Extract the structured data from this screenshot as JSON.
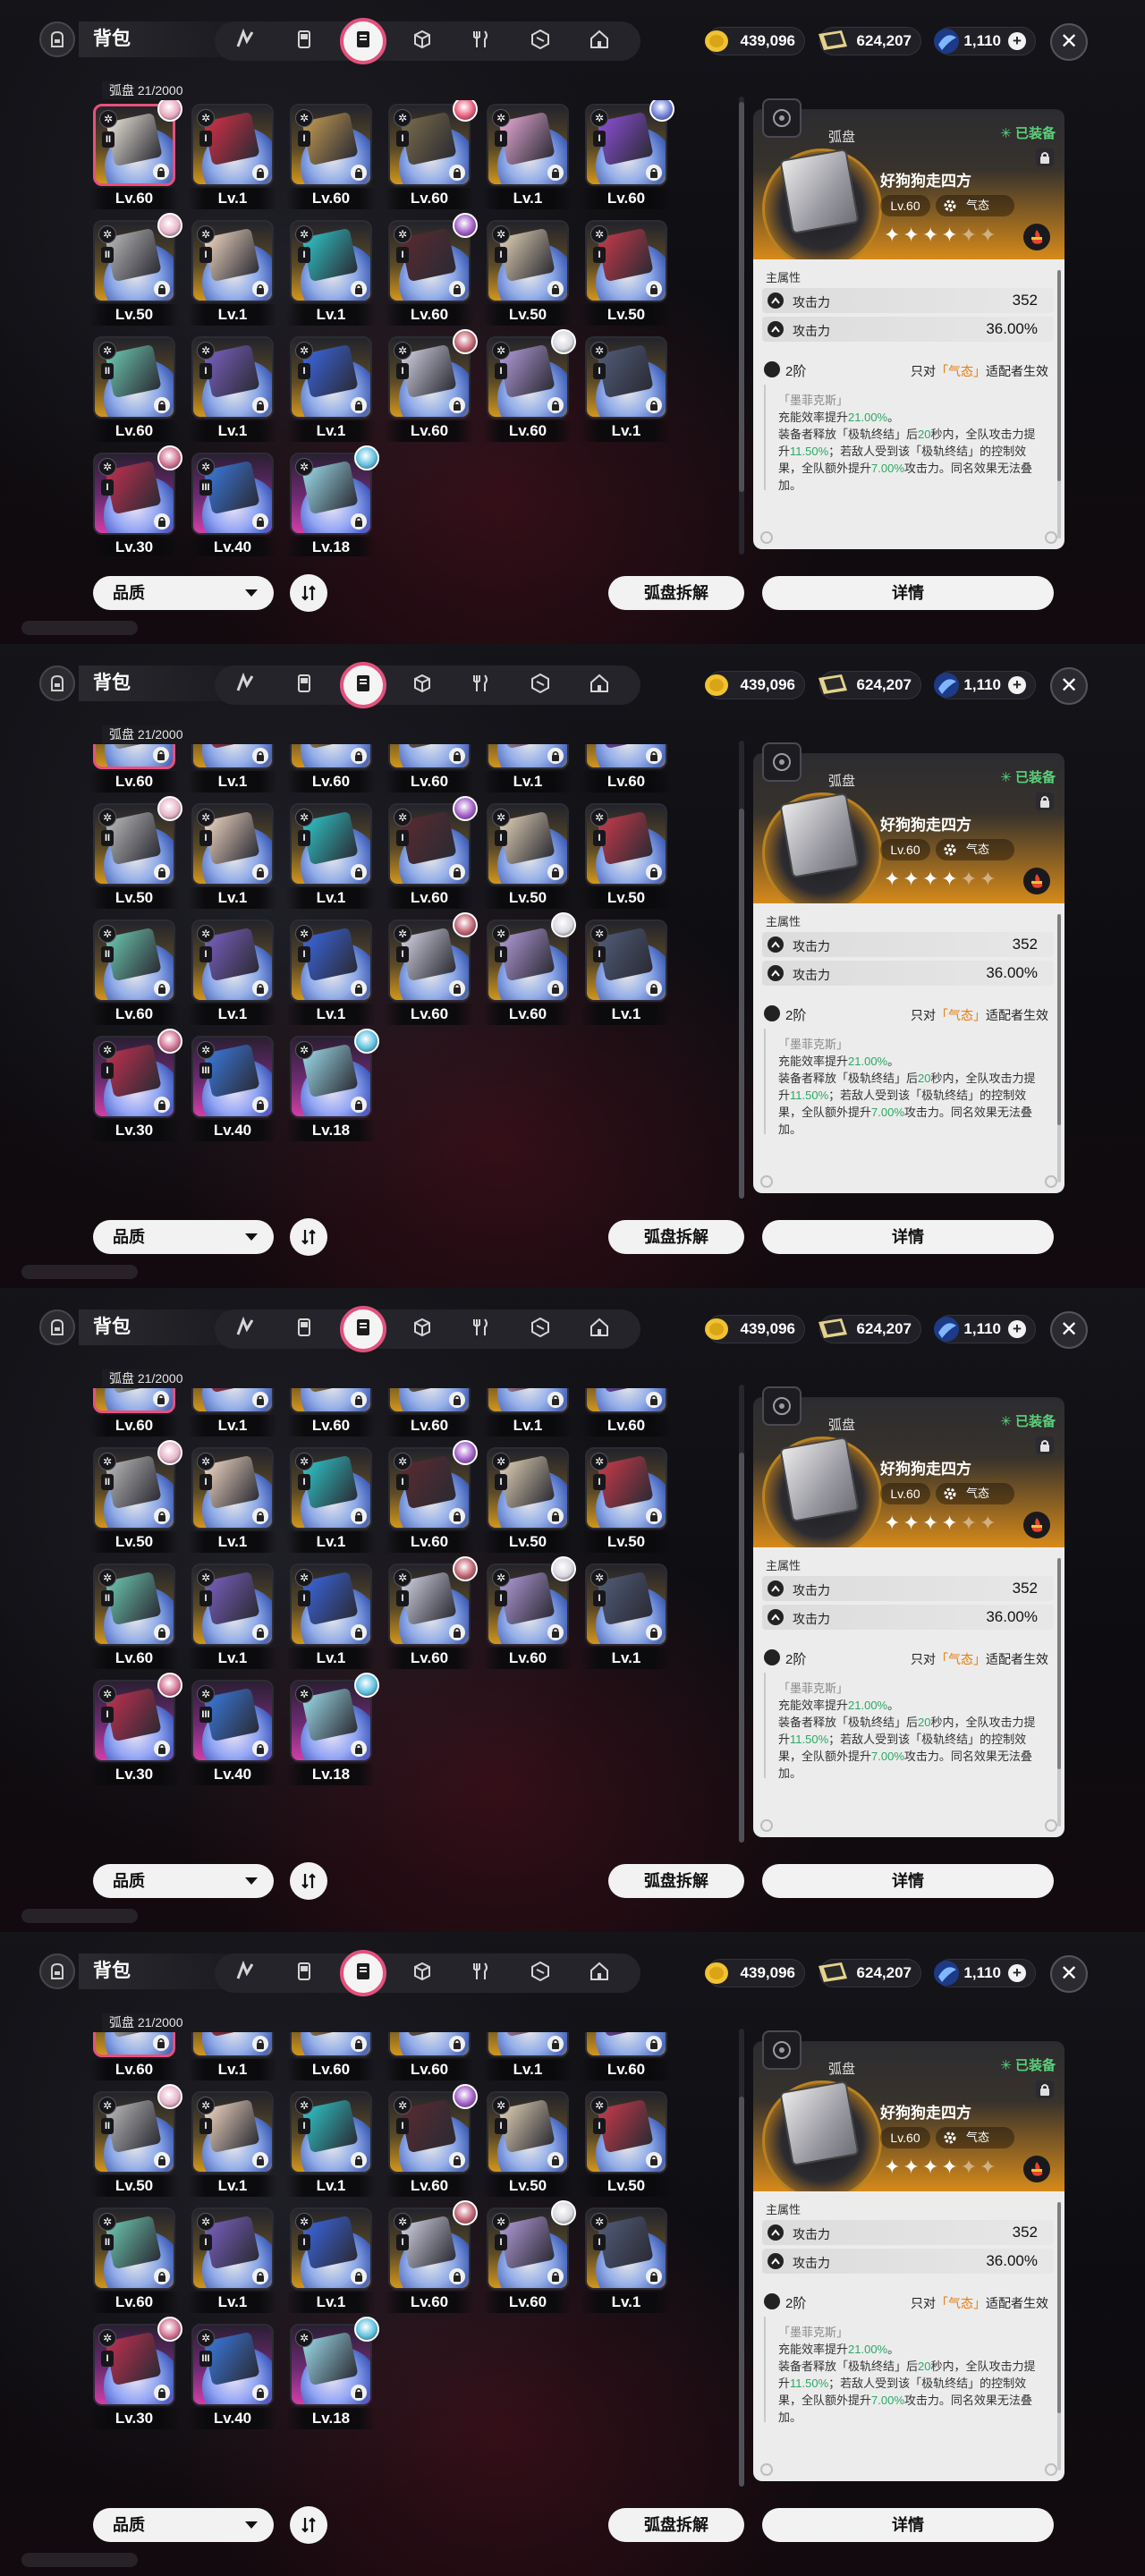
{
  "header": {
    "title": "背包",
    "tabs": [
      "n-mark-icon",
      "device-icon",
      "disc-bag-icon",
      "cube-icon",
      "cutlery-icon",
      "sticker-icon",
      "home-icon"
    ],
    "active_tab_index": 2
  },
  "currencies": [
    {
      "name": "gold-coin-icon",
      "value": "439,096"
    },
    {
      "name": "ticket-icon",
      "value": "624,207"
    },
    {
      "name": "crystal-icon",
      "value": "1,110"
    }
  ],
  "inventory": {
    "count_label": "弧盘  21/2000"
  },
  "items": [
    {
      "lv": "Lv.60",
      "rarity": "gold",
      "rank": "II",
      "art": "#e9e4d8",
      "avatar": "#e9a8c0",
      "selected": true
    },
    {
      "lv": "Lv.1",
      "rarity": "gold",
      "rank": "I",
      "art": "#d43046",
      "avatar": "",
      "selected": false
    },
    {
      "lv": "Lv.60",
      "rarity": "gold",
      "rank": "I",
      "art": "#c29a52",
      "avatar": "",
      "selected": false
    },
    {
      "lv": "Lv.60",
      "rarity": "gold",
      "rank": "I",
      "art": "#7a6c4a",
      "avatar": "#e85a7a",
      "selected": false
    },
    {
      "lv": "Lv.1",
      "rarity": "gold",
      "rank": "I",
      "art": "#e6a9d6",
      "avatar": "",
      "selected": false
    },
    {
      "lv": "Lv.60",
      "rarity": "gold",
      "rank": "I",
      "art": "#8d4fd8",
      "avatar": "#6d7fd8",
      "selected": false
    },
    {
      "lv": "Lv.50",
      "rarity": "gold",
      "rank": "II",
      "art": "#b9b9b9",
      "avatar": "#e6b4c8",
      "selected": false
    },
    {
      "lv": "Lv.1",
      "rarity": "gold",
      "rank": "I",
      "art": "#f0d7c2",
      "avatar": "",
      "selected": false
    },
    {
      "lv": "Lv.1",
      "rarity": "gold",
      "rank": "I",
      "art": "#2ec6c8",
      "avatar": "",
      "selected": false
    },
    {
      "lv": "Lv.60",
      "rarity": "gold",
      "rank": "I",
      "art": "#5a2a30",
      "avatar": "#a05cc8",
      "selected": false
    },
    {
      "lv": "Lv.50",
      "rarity": "gold",
      "rank": "I",
      "art": "#e0d0b4",
      "avatar": "",
      "selected": false
    },
    {
      "lv": "Lv.50",
      "rarity": "gold",
      "rank": "I",
      "art": "#c83a4a",
      "avatar": "",
      "selected": false
    },
    {
      "lv": "Lv.60",
      "rarity": "gold",
      "rank": "II",
      "art": "#6cc7b0",
      "avatar": "",
      "selected": false
    },
    {
      "lv": "Lv.1",
      "rarity": "gold",
      "rank": "I",
      "art": "#7a60c0",
      "avatar": "",
      "selected": false
    },
    {
      "lv": "Lv.1",
      "rarity": "gold",
      "rank": "I",
      "art": "#3a66e0",
      "avatar": "",
      "selected": false
    },
    {
      "lv": "Lv.60",
      "rarity": "gold",
      "rank": "I",
      "art": "#d0d0e0",
      "avatar": "#c06070",
      "selected": false
    },
    {
      "lv": "Lv.60",
      "rarity": "gold",
      "rank": "I",
      "art": "#b09ad8",
      "avatar": "#d8d8e0",
      "selected": false
    },
    {
      "lv": "Lv.1",
      "rarity": "gold",
      "rank": "I",
      "art": "#4f5c78",
      "avatar": "",
      "selected": false
    },
    {
      "lv": "Lv.30",
      "rarity": "purple",
      "rank": "I",
      "art": "#c03050",
      "avatar": "#d07090",
      "selected": false
    },
    {
      "lv": "Lv.40",
      "rarity": "purple",
      "rank": "III",
      "art": "#3a7ae0",
      "avatar": "",
      "selected": false
    },
    {
      "lv": "Lv.18",
      "rarity": "purple",
      "rank": "",
      "art": "#9ad8e6",
      "avatar": "#5cc0e0",
      "selected": false
    }
  ],
  "bottom": {
    "filter_label": "品质",
    "dismantle_label": "弧盘拆解",
    "detail_label": "详情"
  },
  "detail": {
    "category": "弧盘",
    "equipped": "✳ 已装备",
    "name": "好狗狗走四方",
    "level": "Lv.60",
    "element": "气态",
    "stars_filled": "✦✦✦✦",
    "stars_empty": "✦✦",
    "main_attr_title": "主属性",
    "attrs": [
      {
        "name": "攻击力",
        "value": "352"
      },
      {
        "name": "攻击力",
        "value": "36.00%"
      }
    ],
    "tier": "2阶",
    "tier_req_prefix": "只对",
    "tier_req_hl": "「气态」",
    "tier_req_suffix": "适配者生效",
    "desc_title": "「墨菲克斯」",
    "desc_line1_a": "充能效率提升",
    "desc_line1_b": "21.00%",
    "desc_line1_c": "。",
    "desc_line2_a": "装备者释放「极轨终结」后",
    "desc_line2_b": "20",
    "desc_line2_c": "秒内，全队攻击力提",
    "desc_line3_a": "升",
    "desc_line3_b": "11.50%",
    "desc_line3_c": "；若敌人受到该「极轨终结」的控制效",
    "desc_line4_a": "果，全队额外提升",
    "desc_line4_b": "7.00%",
    "desc_line4_c": "攻击力。同名效果无法叠",
    "desc_line5": "加。"
  },
  "screens": {
    "count": 4,
    "grid_scroll": [
      0,
      1,
      1,
      1
    ]
  }
}
